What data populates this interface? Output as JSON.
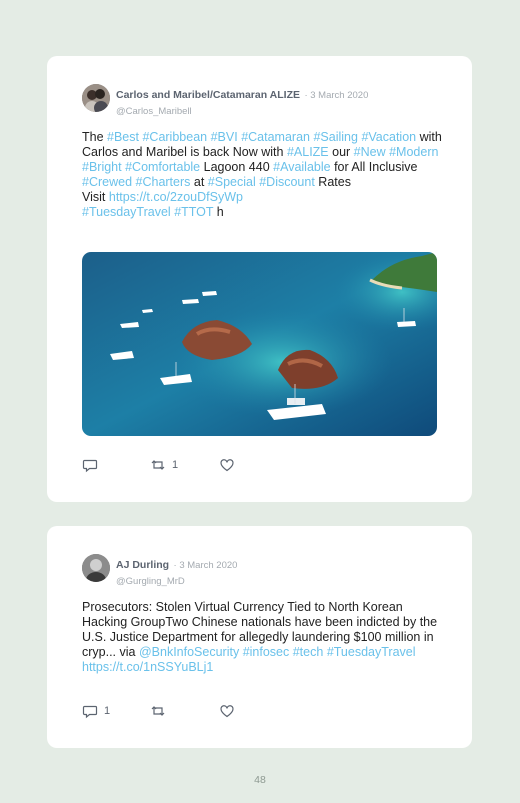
{
  "tweets": [
    {
      "author": "Carlos and Maribel/Catamaran ALIZE",
      "date": "· 3 March 2020",
      "handle": "@Carlos_Maribell",
      "body": [
        {
          "t": "The ",
          "tag": false
        },
        {
          "t": "#Best",
          "tag": true
        },
        {
          "t": " ",
          "tag": false
        },
        {
          "t": "#Caribbean",
          "tag": true
        },
        {
          "t": " ",
          "tag": false
        },
        {
          "t": "#BVI",
          "tag": true
        },
        {
          "t": " ",
          "tag": false
        },
        {
          "t": "#Catamaran",
          "tag": true
        },
        {
          "t": " ",
          "tag": false
        },
        {
          "t": "#Sailing",
          "tag": true
        },
        {
          "t": " ",
          "tag": false
        },
        {
          "t": "#Vacation",
          "tag": true
        },
        {
          "t": " with Carlos and Maribel is back Now with ",
          "tag": false
        },
        {
          "t": "#ALIZE",
          "tag": true
        },
        {
          "t": " our ",
          "tag": false
        },
        {
          "t": "#New",
          "tag": true
        },
        {
          "t": " ",
          "tag": false
        },
        {
          "t": "#Modern",
          "tag": true
        },
        {
          "t": " ",
          "tag": false
        },
        {
          "t": "#Bright",
          "tag": true
        },
        {
          "t": " ",
          "tag": false
        },
        {
          "t": "#Comfortable",
          "tag": true
        },
        {
          "t": " Lagoon 440 ",
          "tag": false
        },
        {
          "t": "#Available",
          "tag": true
        },
        {
          "t": " for All Inclusive ",
          "tag": false
        },
        {
          "t": "#Crewed",
          "tag": true
        },
        {
          "t": " ",
          "tag": false
        },
        {
          "t": "#Charters",
          "tag": true
        },
        {
          "t": " at ",
          "tag": false
        },
        {
          "t": "#Special",
          "tag": true
        },
        {
          "t": " ",
          "tag": false
        },
        {
          "t": "#Discount",
          "tag": true
        },
        {
          "t": " Rates",
          "tag": false
        },
        {
          "br": true
        },
        {
          "t": "Visit ",
          "tag": false
        },
        {
          "t": "https://t.co/2zouDfSyWp",
          "tag": true
        },
        {
          "br": true
        },
        {
          "t": "#TuesdayTravel",
          "tag": true
        },
        {
          "t": " ",
          "tag": false
        },
        {
          "t": "#TTOT",
          "tag": true
        },
        {
          "t": " h",
          "tag": false
        }
      ],
      "reply_count": "",
      "retweet_count": "1",
      "like_count": ""
    },
    {
      "author": "AJ Durling",
      "date": "· 3 March 2020",
      "handle": "@Gurgling_MrD",
      "body": [
        {
          "t": "Prosecutors: Stolen Virtual Currency Tied to North Korean Hacking GroupTwo Chinese nationals have been indicted by the U.S. Justice Department for allegedly laundering $100 million in cryp... via ",
          "tag": false
        },
        {
          "t": "@BnkInfoSecurity",
          "tag": true
        },
        {
          "t": " ",
          "tag": false
        },
        {
          "t": "#infosec",
          "tag": true
        },
        {
          "t": " ",
          "tag": false
        },
        {
          "t": "#tech",
          "tag": true
        },
        {
          "t": " ",
          "tag": false
        },
        {
          "t": "#TuesdayTravel",
          "tag": true
        },
        {
          "t": " ",
          "tag": false
        },
        {
          "t": "https://t.co/1nSSYuBLj1",
          "tag": true
        }
      ],
      "reply_count": "1",
      "retweet_count": "",
      "like_count": ""
    }
  ],
  "page_number": "48",
  "colors": {
    "background": "#e4ece5",
    "link": "#6ac1ea",
    "icon": "#5c6470",
    "name": "#5c6470",
    "meta": "#a4aab0"
  },
  "icons": [
    "reply-icon",
    "retweet-icon",
    "like-icon"
  ]
}
